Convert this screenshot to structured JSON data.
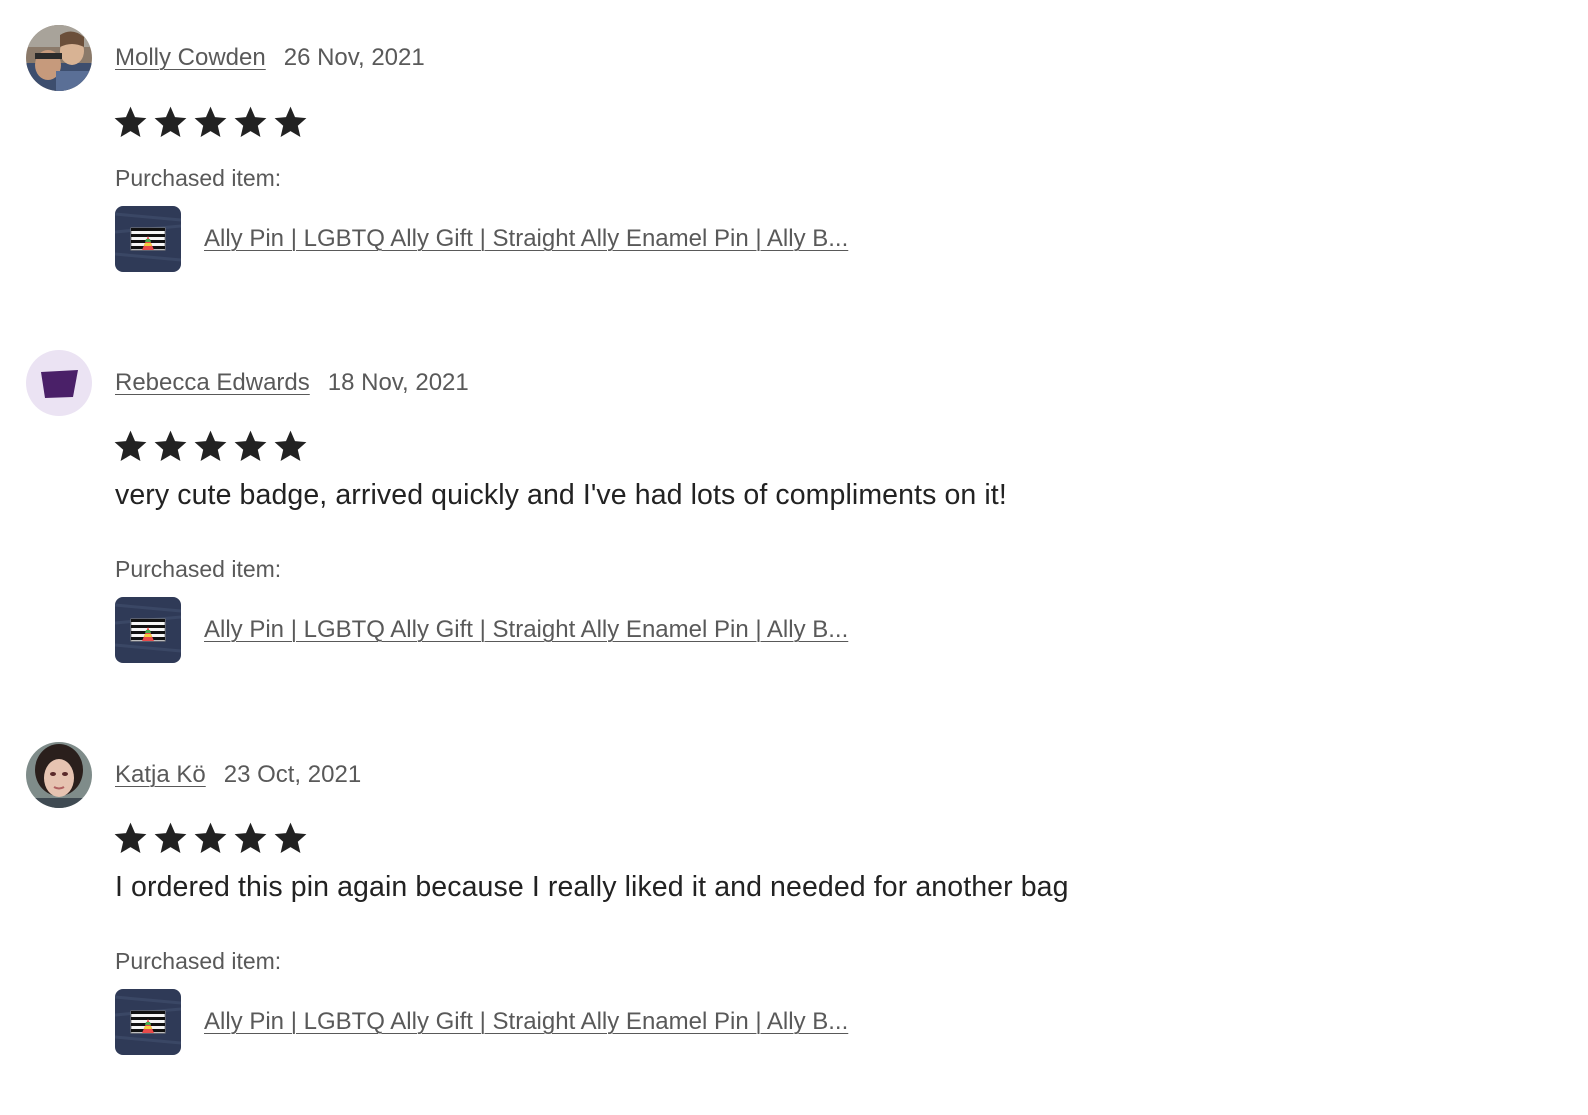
{
  "reviews": [
    {
      "reviewer_name": "Molly Cowden",
      "date": "26 Nov, 2021",
      "rating": 5,
      "rating_max": 5,
      "text": "",
      "purchased_label": "Purchased item:",
      "item_title": "Ally Pin | LGBTQ Ally Gift | Straight Ally Enamel Pin | Ally B..."
    },
    {
      "reviewer_name": "Rebecca Edwards",
      "date": "18 Nov, 2021",
      "rating": 5,
      "rating_max": 5,
      "text": "very cute badge, arrived quickly and I've had lots of compliments on it!",
      "purchased_label": "Purchased item:",
      "item_title": "Ally Pin | LGBTQ Ally Gift | Straight Ally Enamel Pin | Ally B..."
    },
    {
      "reviewer_name": "Katja Kö",
      "date": "23 Oct, 2021",
      "rating": 5,
      "rating_max": 5,
      "text": "I ordered this pin again because I really liked it and needed for another bag",
      "purchased_label": "Purchased item:",
      "item_title": "Ally Pin | LGBTQ Ally Gift | Straight Ally Enamel Pin | Ally B..."
    }
  ],
  "colors": {
    "star": "#222222",
    "meta_text": "#595959",
    "body_text": "#222222",
    "default_avatar_bg": "#ebe3f3",
    "default_avatar_fg": "#4a2068"
  }
}
